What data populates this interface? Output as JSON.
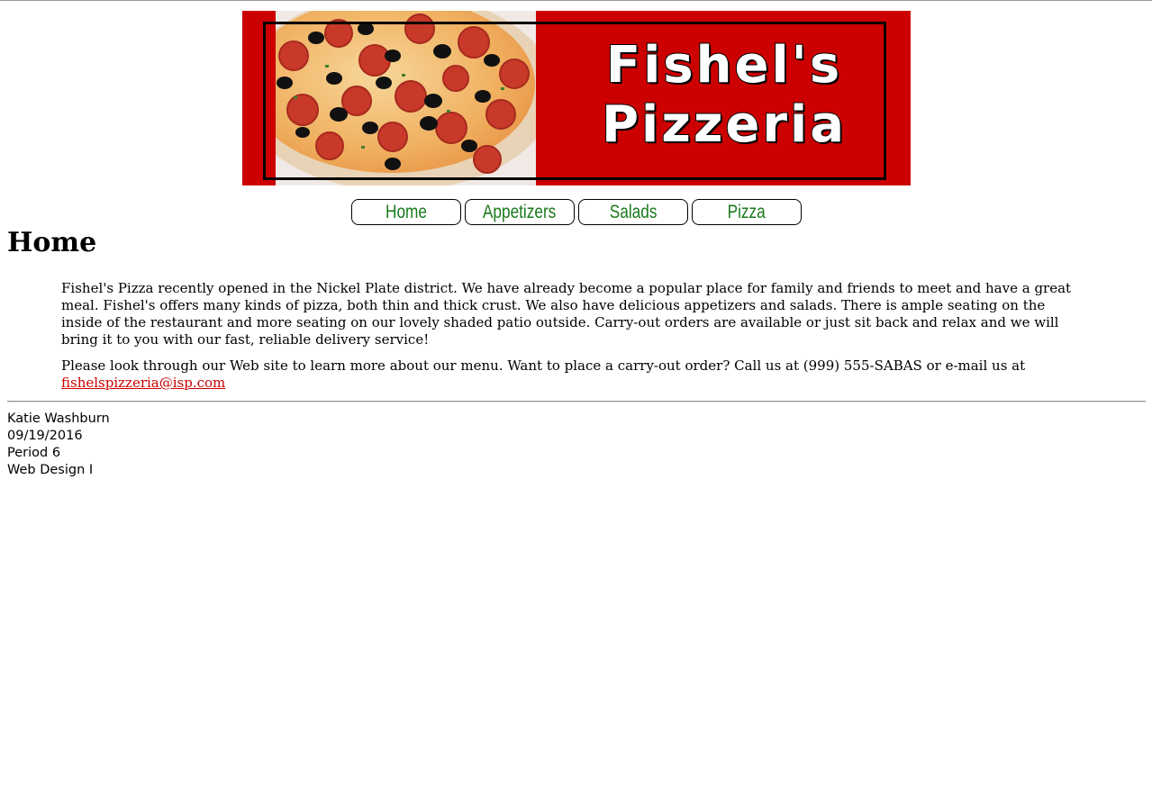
{
  "banner": {
    "title_line1": "Fishel's",
    "title_line2": "Pizzeria",
    "image_alt": "pepperoni and olive pizza photo"
  },
  "nav": {
    "items": [
      {
        "label": "Home"
      },
      {
        "label": "Appetizers"
      },
      {
        "label": "Salads"
      },
      {
        "label": "Pizza"
      }
    ]
  },
  "page": {
    "heading": "Home"
  },
  "content": {
    "paragraph1": "Fishel's Pizza recently opened in the Nickel Plate district. We have already become a popular place for family and friends to meet and have a great meal. Fishel's offers many kinds of pizza, both thin and thick crust. We also have delicious appetizers and salads. There is ample seating on the inside of the restaurant and more seating on our lovely shaded patio outside. Carry-out orders are available or just sit back and relax and we will bring it to you with our fast, reliable delivery service!",
    "paragraph2_text": "Please look through our Web site to learn more about our menu. Want to place a carry-out order? Call us at (999) 555-SABAS or e-mail us at",
    "email": "fishelspizzeria@isp.com"
  },
  "footer": {
    "name": "Katie Washburn",
    "date": "09/19/2016",
    "period": "Period 6",
    "course": "Web Design I"
  },
  "colors": {
    "banner_red": "#cc0000",
    "nav_text_green": "#1a7a1a",
    "link_red": "#cc0000"
  }
}
